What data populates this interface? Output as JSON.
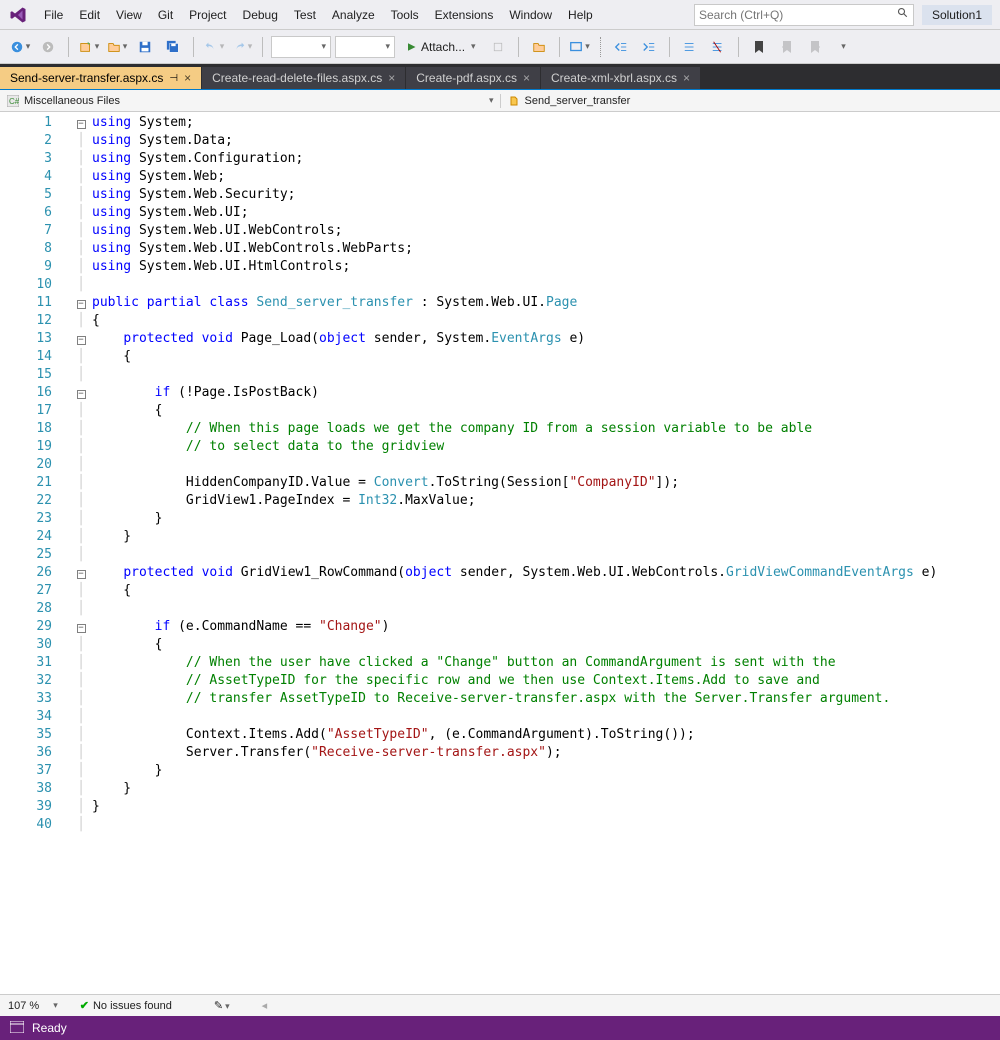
{
  "menu": [
    "File",
    "Edit",
    "View",
    "Git",
    "Project",
    "Debug",
    "Test",
    "Analyze",
    "Tools",
    "Extensions",
    "Window",
    "Help"
  ],
  "search_placeholder": "Search (Ctrl+Q)",
  "solution": "Solution1",
  "attach_label": "Attach...",
  "tabs": [
    {
      "label": "Send-server-transfer.aspx.cs",
      "active": true,
      "pinned": true
    },
    {
      "label": "Create-read-delete-files.aspx.cs",
      "active": false
    },
    {
      "label": "Create-pdf.aspx.cs",
      "active": false
    },
    {
      "label": "Create-xml-xbrl.aspx.cs",
      "active": false
    }
  ],
  "nav_left": "Miscellaneous Files",
  "nav_right": "Send_server_transfer",
  "bottom": {
    "zoom": "107 %",
    "issues": "No issues found"
  },
  "status": "Ready",
  "code_lines": [
    {
      "n": 1,
      "fold": "box",
      "tokens": [
        [
          "kw",
          "using"
        ],
        [
          "pln",
          " System;"
        ]
      ]
    },
    {
      "n": 2,
      "tokens": [
        [
          "kw",
          "using"
        ],
        [
          "pln",
          " System.Data;"
        ]
      ]
    },
    {
      "n": 3,
      "tokens": [
        [
          "kw",
          "using"
        ],
        [
          "pln",
          " System.Configuration;"
        ]
      ]
    },
    {
      "n": 4,
      "tokens": [
        [
          "kw",
          "using"
        ],
        [
          "pln",
          " System.Web;"
        ]
      ]
    },
    {
      "n": 5,
      "tokens": [
        [
          "kw",
          "using"
        ],
        [
          "pln",
          " System.Web.Security;"
        ]
      ]
    },
    {
      "n": 6,
      "tokens": [
        [
          "kw",
          "using"
        ],
        [
          "pln",
          " System.Web.UI;"
        ]
      ]
    },
    {
      "n": 7,
      "tokens": [
        [
          "kw",
          "using"
        ],
        [
          "pln",
          " System.Web.UI.WebControls;"
        ]
      ]
    },
    {
      "n": 8,
      "tokens": [
        [
          "kw",
          "using"
        ],
        [
          "pln",
          " System.Web.UI.WebControls.WebParts;"
        ]
      ]
    },
    {
      "n": 9,
      "tokens": [
        [
          "kw",
          "using"
        ],
        [
          "pln",
          " System.Web.UI.HtmlControls;"
        ]
      ]
    },
    {
      "n": 10,
      "tokens": [
        [
          "pln",
          ""
        ]
      ]
    },
    {
      "n": 11,
      "fold": "box",
      "tokens": [
        [
          "kw",
          "public"
        ],
        [
          "pln",
          " "
        ],
        [
          "kw",
          "partial"
        ],
        [
          "pln",
          " "
        ],
        [
          "kw",
          "class"
        ],
        [
          "pln",
          " "
        ],
        [
          "typ",
          "Send_server_transfer"
        ],
        [
          "pln",
          " : System.Web.UI."
        ],
        [
          "typ",
          "Page"
        ]
      ]
    },
    {
      "n": 12,
      "tokens": [
        [
          "pln",
          "{"
        ]
      ]
    },
    {
      "n": 13,
      "fold": "box",
      "tokens": [
        [
          "pln",
          "    "
        ],
        [
          "kw",
          "protected"
        ],
        [
          "pln",
          " "
        ],
        [
          "kw",
          "void"
        ],
        [
          "pln",
          " Page_Load("
        ],
        [
          "kw",
          "object"
        ],
        [
          "pln",
          " sender, System."
        ],
        [
          "typ",
          "EventArgs"
        ],
        [
          "pln",
          " e)"
        ]
      ]
    },
    {
      "n": 14,
      "tokens": [
        [
          "pln",
          "    {"
        ]
      ]
    },
    {
      "n": 15,
      "tokens": [
        [
          "pln",
          ""
        ]
      ]
    },
    {
      "n": 16,
      "fold": "box",
      "tokens": [
        [
          "pln",
          "        "
        ],
        [
          "kw",
          "if"
        ],
        [
          "pln",
          " (!Page.IsPostBack)"
        ]
      ]
    },
    {
      "n": 17,
      "tokens": [
        [
          "pln",
          "        {"
        ]
      ]
    },
    {
      "n": 18,
      "tokens": [
        [
          "pln",
          "            "
        ],
        [
          "com",
          "// When this page loads we get the company ID from a session variable to be able"
        ]
      ]
    },
    {
      "n": 19,
      "tokens": [
        [
          "pln",
          "            "
        ],
        [
          "com",
          "// to select data to the gridview"
        ]
      ]
    },
    {
      "n": 20,
      "tokens": [
        [
          "pln",
          ""
        ]
      ]
    },
    {
      "n": 21,
      "tokens": [
        [
          "pln",
          "            HiddenCompanyID.Value = "
        ],
        [
          "typ",
          "Convert"
        ],
        [
          "pln",
          ".ToString(Session["
        ],
        [
          "str",
          "\"CompanyID\""
        ],
        [
          "pln",
          "]);"
        ]
      ]
    },
    {
      "n": 22,
      "tokens": [
        [
          "pln",
          "            GridView1.PageIndex = "
        ],
        [
          "typ",
          "Int32"
        ],
        [
          "pln",
          ".MaxValue;"
        ]
      ]
    },
    {
      "n": 23,
      "tokens": [
        [
          "pln",
          "        }"
        ]
      ]
    },
    {
      "n": 24,
      "tokens": [
        [
          "pln",
          "    }"
        ]
      ]
    },
    {
      "n": 25,
      "tokens": [
        [
          "pln",
          ""
        ]
      ]
    },
    {
      "n": 26,
      "fold": "box",
      "tokens": [
        [
          "pln",
          "    "
        ],
        [
          "kw",
          "protected"
        ],
        [
          "pln",
          " "
        ],
        [
          "kw",
          "void"
        ],
        [
          "pln",
          " GridView1_RowCommand("
        ],
        [
          "kw",
          "object"
        ],
        [
          "pln",
          " sender, System.Web.UI.WebControls."
        ],
        [
          "typ",
          "GridViewCommandEventArgs"
        ],
        [
          "pln",
          " e)"
        ]
      ]
    },
    {
      "n": 27,
      "tokens": [
        [
          "pln",
          "    {"
        ]
      ]
    },
    {
      "n": 28,
      "tokens": [
        [
          "pln",
          ""
        ]
      ]
    },
    {
      "n": 29,
      "fold": "box",
      "tokens": [
        [
          "pln",
          "        "
        ],
        [
          "kw",
          "if"
        ],
        [
          "pln",
          " (e.CommandName == "
        ],
        [
          "str",
          "\"Change\""
        ],
        [
          "pln",
          ")"
        ]
      ]
    },
    {
      "n": 30,
      "tokens": [
        [
          "pln",
          "        {"
        ]
      ]
    },
    {
      "n": 31,
      "tokens": [
        [
          "pln",
          "            "
        ],
        [
          "com",
          "// When the user have clicked a \"Change\" button an CommandArgument is sent with the"
        ]
      ]
    },
    {
      "n": 32,
      "tokens": [
        [
          "pln",
          "            "
        ],
        [
          "com",
          "// AssetTypeID for the specific row and we then use Context.Items.Add to save and"
        ]
      ]
    },
    {
      "n": 33,
      "tokens": [
        [
          "pln",
          "            "
        ],
        [
          "com",
          "// transfer AssetTypeID to Receive-server-transfer.aspx with the Server.Transfer argument."
        ]
      ]
    },
    {
      "n": 34,
      "tokens": [
        [
          "pln",
          ""
        ]
      ]
    },
    {
      "n": 35,
      "tokens": [
        [
          "pln",
          "            Context.Items.Add("
        ],
        [
          "str",
          "\"AssetTypeID\""
        ],
        [
          "pln",
          ", (e.CommandArgument).ToString());"
        ]
      ]
    },
    {
      "n": 36,
      "tokens": [
        [
          "pln",
          "            Server.Transfer("
        ],
        [
          "str",
          "\"Receive-server-transfer.aspx\""
        ],
        [
          "pln",
          ");"
        ]
      ]
    },
    {
      "n": 37,
      "tokens": [
        [
          "pln",
          "        }"
        ]
      ]
    },
    {
      "n": 38,
      "tokens": [
        [
          "pln",
          "    }"
        ]
      ]
    },
    {
      "n": 39,
      "tokens": [
        [
          "pln",
          "}"
        ]
      ]
    },
    {
      "n": 40,
      "tokens": [
        [
          "pln",
          ""
        ]
      ]
    }
  ]
}
